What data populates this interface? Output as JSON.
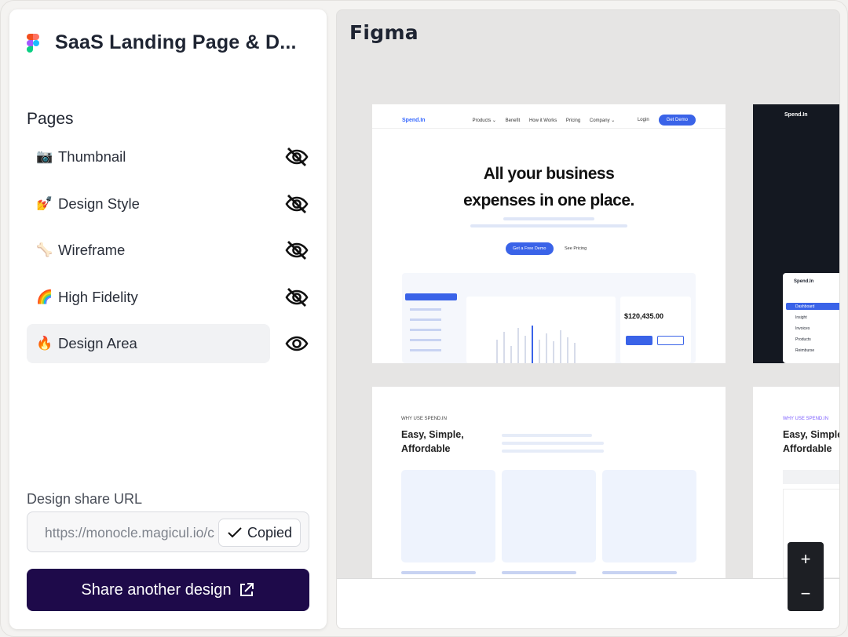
{
  "app": {
    "title": "SaaS Landing Page & D..."
  },
  "pages": {
    "heading": "Pages",
    "items": [
      {
        "emoji": "📷",
        "label": "Thumbnail",
        "visible": false
      },
      {
        "emoji": "💅",
        "label": "Design Style",
        "visible": false
      },
      {
        "emoji": "🦴",
        "label": "Wireframe",
        "visible": false
      },
      {
        "emoji": "🌈",
        "label": "High Fidelity",
        "visible": false
      },
      {
        "emoji": "🔥",
        "label": "Design Area",
        "visible": true,
        "active": true
      }
    ]
  },
  "share": {
    "label": "Design share URL",
    "url": "https://monocle.magicul.io/c",
    "copied_label": "Copied",
    "button_label": "Share another design"
  },
  "preview": {
    "title": "Figma",
    "zoom_in": "+",
    "zoom_out": "−",
    "card1": {
      "brand": "Spend.In",
      "nav": [
        "Products ⌄",
        "Benefit",
        "How it Works",
        "Pricing",
        "Company ⌄"
      ],
      "login": "Login",
      "demo": "Get Demo",
      "hero_line1": "All your business",
      "hero_line2": "expenses in one place.",
      "cta_primary": "Get a Free Demo",
      "cta_secondary": "See Pricing",
      "money": "$120,435.00"
    },
    "card2": {
      "brand": "Spend.In",
      "menu": [
        "Dashboard",
        "Insight",
        "Invoices",
        "Products",
        "Reimburse"
      ]
    },
    "card3": {
      "eyebrow": "WHY USE SPEND.IN",
      "heading": "Easy, Simple, Affordable"
    },
    "card4": {
      "eyebrow": "WHY USE SPEND.IN",
      "heading": "Easy, Simple Affordable"
    }
  },
  "colors": {
    "accent": "#1e0a4a",
    "brand_blue": "#3a63e8"
  },
  "icons": {
    "visibility_off": "eye-off-icon",
    "visibility_on": "eye-icon",
    "check": "check-icon",
    "external": "external-link-icon",
    "figma": "figma-logo-icon"
  }
}
